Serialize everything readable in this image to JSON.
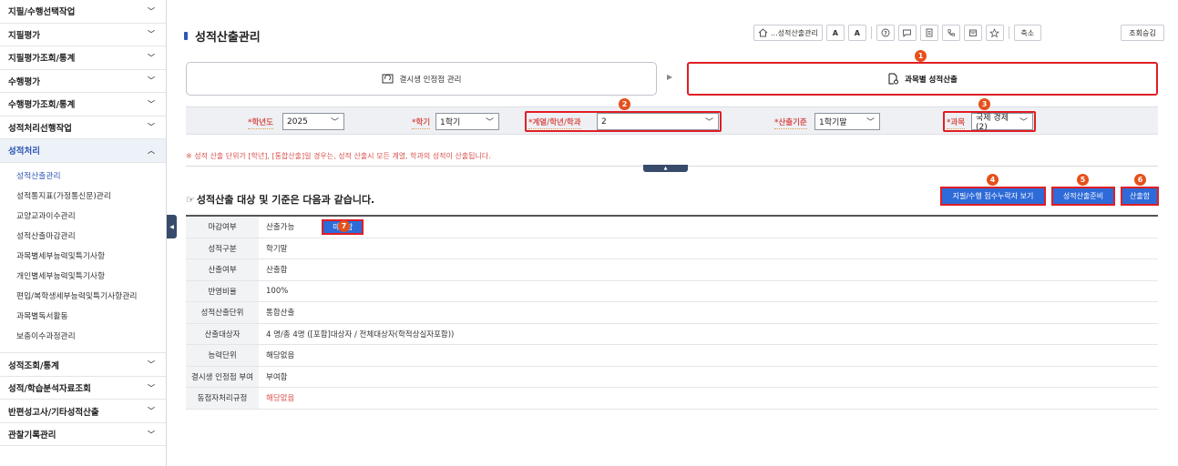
{
  "sidebar": {
    "items_top": [
      {
        "label": "지필/수행선택작업"
      },
      {
        "label": "지필평가"
      },
      {
        "label": "지필평가조회/통계"
      },
      {
        "label": "수행평가"
      },
      {
        "label": "수행평가조회/통계"
      },
      {
        "label": "성적처리선행작업"
      }
    ],
    "active": {
      "label": "성적처리"
    },
    "subitems": [
      {
        "label": "성적산출관리"
      },
      {
        "label": "성적통지표(가정통신문)관리"
      },
      {
        "label": "교양교과이수관리"
      },
      {
        "label": "성적산출마감관리"
      },
      {
        "label": "과목별세부능력및특기사항"
      },
      {
        "label": "개인별세부능력및특기사항"
      },
      {
        "label": "편입/복학생세부능력및특기사항관리"
      },
      {
        "label": "과목별독서활동"
      },
      {
        "label": "보충이수과정관리"
      }
    ],
    "items_bottom": [
      {
        "label": "성적조회/통계"
      },
      {
        "label": "성적/학습분석자료조회"
      },
      {
        "label": "반편성고사/기타성적산출"
      },
      {
        "label": "관찰기록관리"
      }
    ]
  },
  "header": {
    "title": "성적산출관리",
    "breadcrumb": "...성적산출관리",
    "font_a1": "A",
    "font_a2": "A",
    "shrink": "축소",
    "lookup_approval": "조회승김"
  },
  "steps": {
    "step1": "결시생 인정점 관리",
    "step2": "과목별 성적산출"
  },
  "filters": {
    "year_label": "*학년도",
    "year_value": "2025",
    "semester_label": "*학기",
    "semester_value": "1학기",
    "dept_label": "*계열/학년/학과",
    "dept_value": "2",
    "basis_label": "*산출기준",
    "basis_value": "1학기말",
    "subject_label": "*과목",
    "subject_value": "국제 경제(2)"
  },
  "notice": "※ 성적 산출 단위가 [학년], [통합산출]일 경우는, 성적 산출시 모든 계열, 학과의 성적이 산출됩니다.",
  "section": {
    "icon": "☞",
    "title": "성적산출 대상 및 기준은 다음과 같습니다."
  },
  "actions": {
    "view_scores": "지필/수행 점수누락자 보기",
    "prepare": "성적산출준비",
    "calculate": "산출함"
  },
  "badges": [
    "1",
    "2",
    "3",
    "4",
    "5",
    "6",
    "7"
  ],
  "info": {
    "rows": [
      {
        "k": "마감여부",
        "v": "산출가능"
      },
      {
        "k": "성적구분",
        "v": "학기말"
      },
      {
        "k": "산출여부",
        "v": "산출함"
      },
      {
        "k": "반영비율",
        "v": "100%"
      },
      {
        "k": "성적산출단위",
        "v": "통합산출"
      },
      {
        "k": "산출대상자",
        "v": "4 명/총 4명 ([포함]대상자 / 전체대상자(학적상실자포함))"
      },
      {
        "k": "능력단위",
        "v": "해당없음"
      },
      {
        "k": "결시생 인정점 부여",
        "v": "부여함"
      },
      {
        "k": "동점자처리규정",
        "v": "해당없음"
      }
    ],
    "close_button": "마감함"
  },
  "colors": {
    "accent": "#2f6bd8",
    "highlight": "#e01e25",
    "badge": "#e5501b",
    "warning_text": "#d9534f"
  },
  "icons": [
    "home-icon",
    "help-icon",
    "chat-icon",
    "doc-icon",
    "phone-icon",
    "calendar-icon",
    "star-icon",
    "refresh-doc-icon",
    "doc-gear-icon",
    "collapse-left-icon",
    "collapse-up-icon"
  ]
}
